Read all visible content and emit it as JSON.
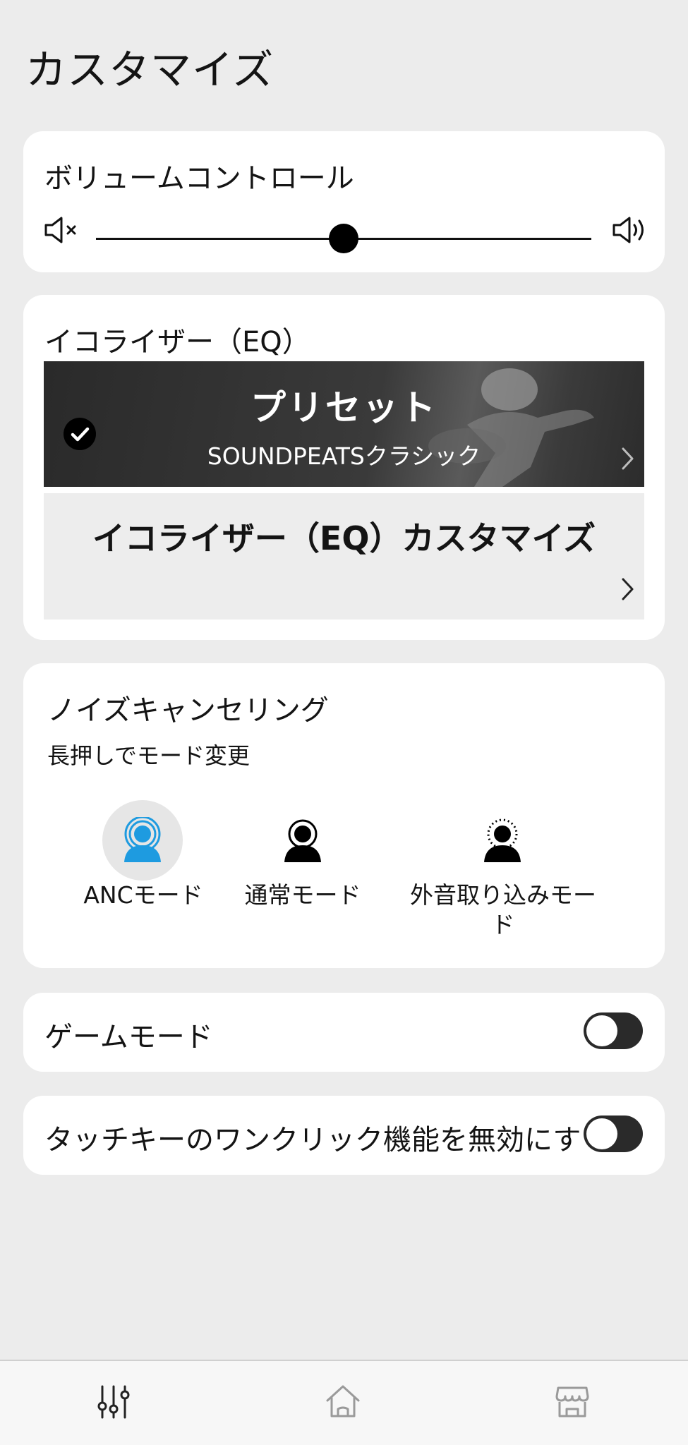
{
  "page": {
    "title": "カスタマイズ"
  },
  "volume": {
    "title": "ボリュームコントロール",
    "level_percent": 50,
    "icons": {
      "min": "mute-icon",
      "max": "speaker-icon"
    }
  },
  "eq": {
    "title": "イコライザー（EQ）",
    "preset": {
      "title": "プリセット",
      "selected": "SOUNDPEATSクラシック",
      "checked": true
    },
    "custom": {
      "title": "イコライザー（EQ）カスタマイズ"
    }
  },
  "noise_cancelling": {
    "title": "ノイズキャンセリング",
    "subtitle": "長押しでモード変更",
    "modes": [
      {
        "label": "ANCモード",
        "active": true,
        "icon": "anc-icon",
        "color": "#1e9be0"
      },
      {
        "label": "通常モード",
        "active": false,
        "icon": "normal-icon",
        "color": "#000000"
      },
      {
        "label": "外音取り込みモー\nド",
        "active": false,
        "icon": "ambient-icon",
        "color": "#000000"
      }
    ]
  },
  "game_mode": {
    "label": "ゲームモード",
    "on": false
  },
  "touch_key": {
    "label": "タッチキーのワンクリック機能を無効にす",
    "on": false
  },
  "bottom_nav": {
    "items": [
      "equalizer-icon",
      "home-icon",
      "store-icon"
    ]
  }
}
